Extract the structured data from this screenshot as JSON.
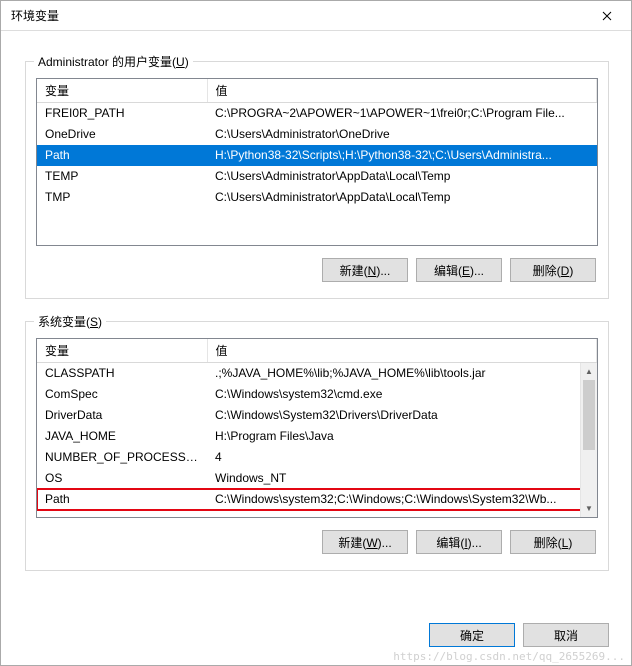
{
  "titlebar": {
    "title": "环境变量"
  },
  "user": {
    "group_label_prefix": "Administrator 的用户变量(",
    "group_label_key": "U",
    "group_label_suffix": ")",
    "headers": {
      "name": "变量",
      "value": "值"
    },
    "rows": [
      {
        "name": "FREI0R_PATH",
        "value": "C:\\PROGRA~2\\APOWER~1\\APOWER~1\\frei0r;C:\\Program File..."
      },
      {
        "name": "OneDrive",
        "value": "C:\\Users\\Administrator\\OneDrive"
      },
      {
        "name": "Path",
        "value": "H:\\Python38-32\\Scripts\\;H:\\Python38-32\\;C:\\Users\\Administra..."
      },
      {
        "name": "TEMP",
        "value": "C:\\Users\\Administrator\\AppData\\Local\\Temp"
      },
      {
        "name": "TMP",
        "value": "C:\\Users\\Administrator\\AppData\\Local\\Temp"
      }
    ],
    "selected_index": 2,
    "buttons": {
      "new": "新建(N)...",
      "edit": "编辑(E)...",
      "delete": "删除(D)"
    },
    "button_keys": {
      "new": "N",
      "edit": "E",
      "delete": "D"
    }
  },
  "system": {
    "group_label_prefix": "系统变量(",
    "group_label_key": "S",
    "group_label_suffix": ")",
    "headers": {
      "name": "变量",
      "value": "值"
    },
    "rows": [
      {
        "name": "CLASSPATH",
        "value": ".;%JAVA_HOME%\\lib;%JAVA_HOME%\\lib\\tools.jar"
      },
      {
        "name": "ComSpec",
        "value": "C:\\Windows\\system32\\cmd.exe"
      },
      {
        "name": "DriverData",
        "value": "C:\\Windows\\System32\\Drivers\\DriverData"
      },
      {
        "name": "JAVA_HOME",
        "value": "H:\\Program Files\\Java"
      },
      {
        "name": "NUMBER_OF_PROCESSORS",
        "value": "4"
      },
      {
        "name": "OS",
        "value": "Windows_NT"
      },
      {
        "name": "Path",
        "value": "C:\\Windows\\system32;C:\\Windows;C:\\Windows\\System32\\Wb..."
      }
    ],
    "highlighted_index": 6,
    "buttons": {
      "new": "新建(W)...",
      "edit": "编辑(I)...",
      "delete": "删除(L)"
    },
    "button_keys": {
      "new": "W",
      "edit": "I",
      "delete": "L"
    }
  },
  "dialog_buttons": {
    "ok": "确定",
    "cancel": "取消"
  },
  "watermark": "https://blog.csdn.net/qq_2655269..."
}
